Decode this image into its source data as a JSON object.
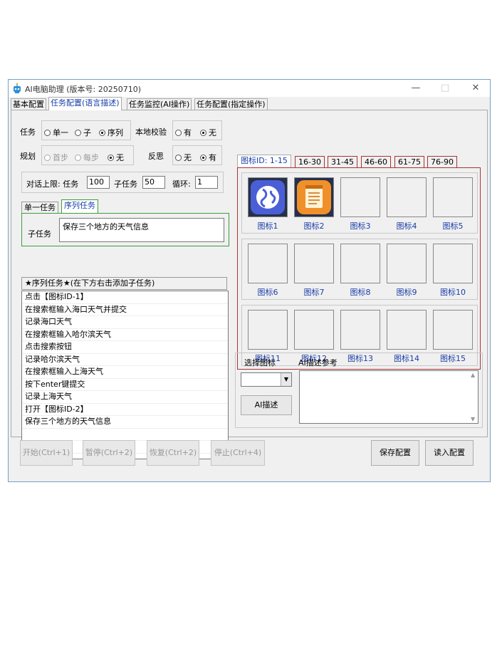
{
  "window": {
    "title": "AI电脑助理 (版本号: 20250710)",
    "controls": {
      "minimize": "—",
      "maximize": "□",
      "close": "✕"
    }
  },
  "main_tabs": [
    "基本配置",
    "任务配置(语言描述)",
    "任务监控(AI操作)",
    "任务配置(指定操作)"
  ],
  "task": {
    "label": "任务",
    "options": [
      "单一",
      "子",
      "序列"
    ],
    "selected": "序列"
  },
  "local_check": {
    "label": "本地校验",
    "options": [
      "有",
      "无"
    ],
    "selected": "无"
  },
  "plan": {
    "label": "规划",
    "options": [
      "首步",
      "每步",
      "无"
    ],
    "selected": "无"
  },
  "reflect": {
    "label": "反思",
    "options": [
      "无",
      "有"
    ],
    "selected": "有"
  },
  "limits": {
    "label": "对话上限: 任务",
    "task_value": "100",
    "subtask_label": "子任务",
    "subtask_value": "50",
    "loop_label": "循环:",
    "loop_value": "1"
  },
  "sub_tabs": [
    "单一任务",
    "序列任务"
  ],
  "subtask": {
    "label": "子任务",
    "value": "保存三个地方的天气信息"
  },
  "sequence": {
    "header": "★序列任务★(在下方右击添加子任务)",
    "items": [
      "点击【图标ID-1】",
      "在搜索框输入海口天气并提交",
      "记录海口天气",
      "在搜索框输入哈尔滨天气",
      "点击搜索按钮",
      "记录哈尔滨天气",
      "在搜索框输入上海天气",
      "按下enter键提交",
      "记录上海天气",
      "打开【图标ID-2】",
      "保存三个地方的天气信息",
      "",
      "",
      ""
    ]
  },
  "icon_tabs": [
    "图标ID: 1-15",
    "16-30",
    "31-45",
    "46-60",
    "61-75",
    "76-90"
  ],
  "icons": [
    {
      "label": "图标1",
      "icon": "globe-icon",
      "color": "#4a5fd6"
    },
    {
      "label": "图标2",
      "icon": "notepad-icon",
      "color": "#f0902a"
    },
    {
      "label": "图标3",
      "icon": ""
    },
    {
      "label": "图标4",
      "icon": ""
    },
    {
      "label": "图标5",
      "icon": ""
    },
    {
      "label": "图标6",
      "icon": ""
    },
    {
      "label": "图标7",
      "icon": ""
    },
    {
      "label": "图标8",
      "icon": ""
    },
    {
      "label": "图标9",
      "icon": ""
    },
    {
      "label": "图标10",
      "icon": ""
    },
    {
      "label": "图标11",
      "icon": ""
    },
    {
      "label": "图标12",
      "icon": ""
    },
    {
      "label": "图标13",
      "icon": ""
    },
    {
      "label": "图标14",
      "icon": ""
    },
    {
      "label": "图标15",
      "icon": ""
    }
  ],
  "select_icon": {
    "label": "选择图标",
    "value": ""
  },
  "ai_desc": {
    "label": "AI描述参考",
    "button": "AI描述",
    "value": ""
  },
  "buttons": {
    "start": "开始(Ctrl+1)",
    "pause": "暂停(Ctrl+2)",
    "resume": "恢复(Ctrl+2)",
    "stop": "停止(Ctrl+4)",
    "save": "保存配置",
    "load": "读入配置"
  }
}
